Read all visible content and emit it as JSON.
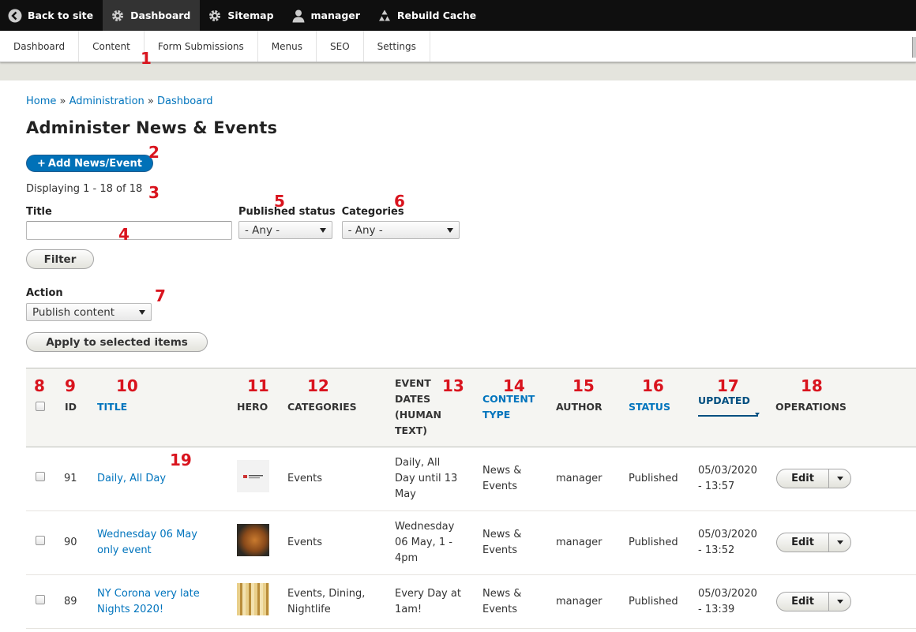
{
  "toolbar": {
    "items": [
      {
        "label": "Back to site",
        "icon": "back-arrow-icon"
      },
      {
        "label": "Dashboard",
        "icon": "gear-icon"
      },
      {
        "label": "Sitemap",
        "icon": "gear-icon"
      },
      {
        "label": "manager",
        "icon": "user-icon"
      },
      {
        "label": "Rebuild Cache",
        "icon": "recycle-icon"
      }
    ]
  },
  "tray": {
    "items": [
      "Dashboard",
      "Content",
      "Form Submissions",
      "Menus",
      "SEO",
      "Settings"
    ]
  },
  "breadcrumb": [
    "Home",
    "Administration",
    "Dashboard"
  ],
  "breadcrumb_sep": "»",
  "page_title": "Administer News & Events",
  "add_button": "Add News/Event",
  "displaying": "Displaying 1 - 18 of 18",
  "filters": {
    "title_label": "Title",
    "title_value": "",
    "published_label": "Published status",
    "published_value": "- Any -",
    "categories_label": "Categories",
    "categories_value": "- Any -",
    "filter_button": "Filter"
  },
  "action": {
    "label": "Action",
    "value": "Publish content",
    "apply_button": "Apply to selected items"
  },
  "table": {
    "headers": {
      "id": "ID",
      "title": "TITLE",
      "hero": "HERO",
      "categories": "CATEGORIES",
      "event_dates": [
        "EVENT",
        "DATES",
        "(HUMAN",
        "TEXT)"
      ],
      "content_type": [
        "CONTENT",
        "TYPE"
      ],
      "author": "AUTHOR",
      "status": "STATUS",
      "updated": "UPDATED",
      "operations": "OPERATIONS"
    },
    "rows": [
      {
        "id": "91",
        "title": [
          "Daily, All Day"
        ],
        "categories": [
          "Events"
        ],
        "dates": [
          "Daily, All",
          "Day until 13",
          "May"
        ],
        "type": [
          "News &",
          "Events"
        ],
        "author": "manager",
        "status": "Published",
        "updated": [
          "05/03/2020",
          "- 13:57"
        ],
        "op": "Edit"
      },
      {
        "id": "90",
        "title": [
          "Wednesday 06 May",
          "only event"
        ],
        "categories": [
          "Events"
        ],
        "dates": [
          "Wednesday",
          "06 May, 1 -",
          "4pm"
        ],
        "type": [
          "News &",
          "Events"
        ],
        "author": "manager",
        "status": "Published",
        "updated": [
          "05/03/2020",
          "- 13:52"
        ],
        "op": "Edit"
      },
      {
        "id": "89",
        "title": [
          "NY Corona very late",
          "Nights 2020!"
        ],
        "categories": [
          "Events, Dining,",
          "Nightlife"
        ],
        "dates": [
          "Every Day at",
          "1am!"
        ],
        "type": [
          "News &",
          "Events"
        ],
        "author": "manager",
        "status": "Published",
        "updated": [
          "05/03/2020",
          "- 13:39"
        ],
        "op": "Edit"
      }
    ]
  },
  "annotations": [
    "1",
    "2",
    "3",
    "4",
    "5",
    "6",
    "7",
    "8",
    "9",
    "10",
    "11",
    "12",
    "13",
    "14",
    "15",
    "16",
    "17",
    "18",
    "19"
  ],
  "colors": {
    "link": "#0074bd",
    "primary_button": "#0071b8",
    "annotation": "#d9141e",
    "toolbar": "#0f0f0f"
  }
}
